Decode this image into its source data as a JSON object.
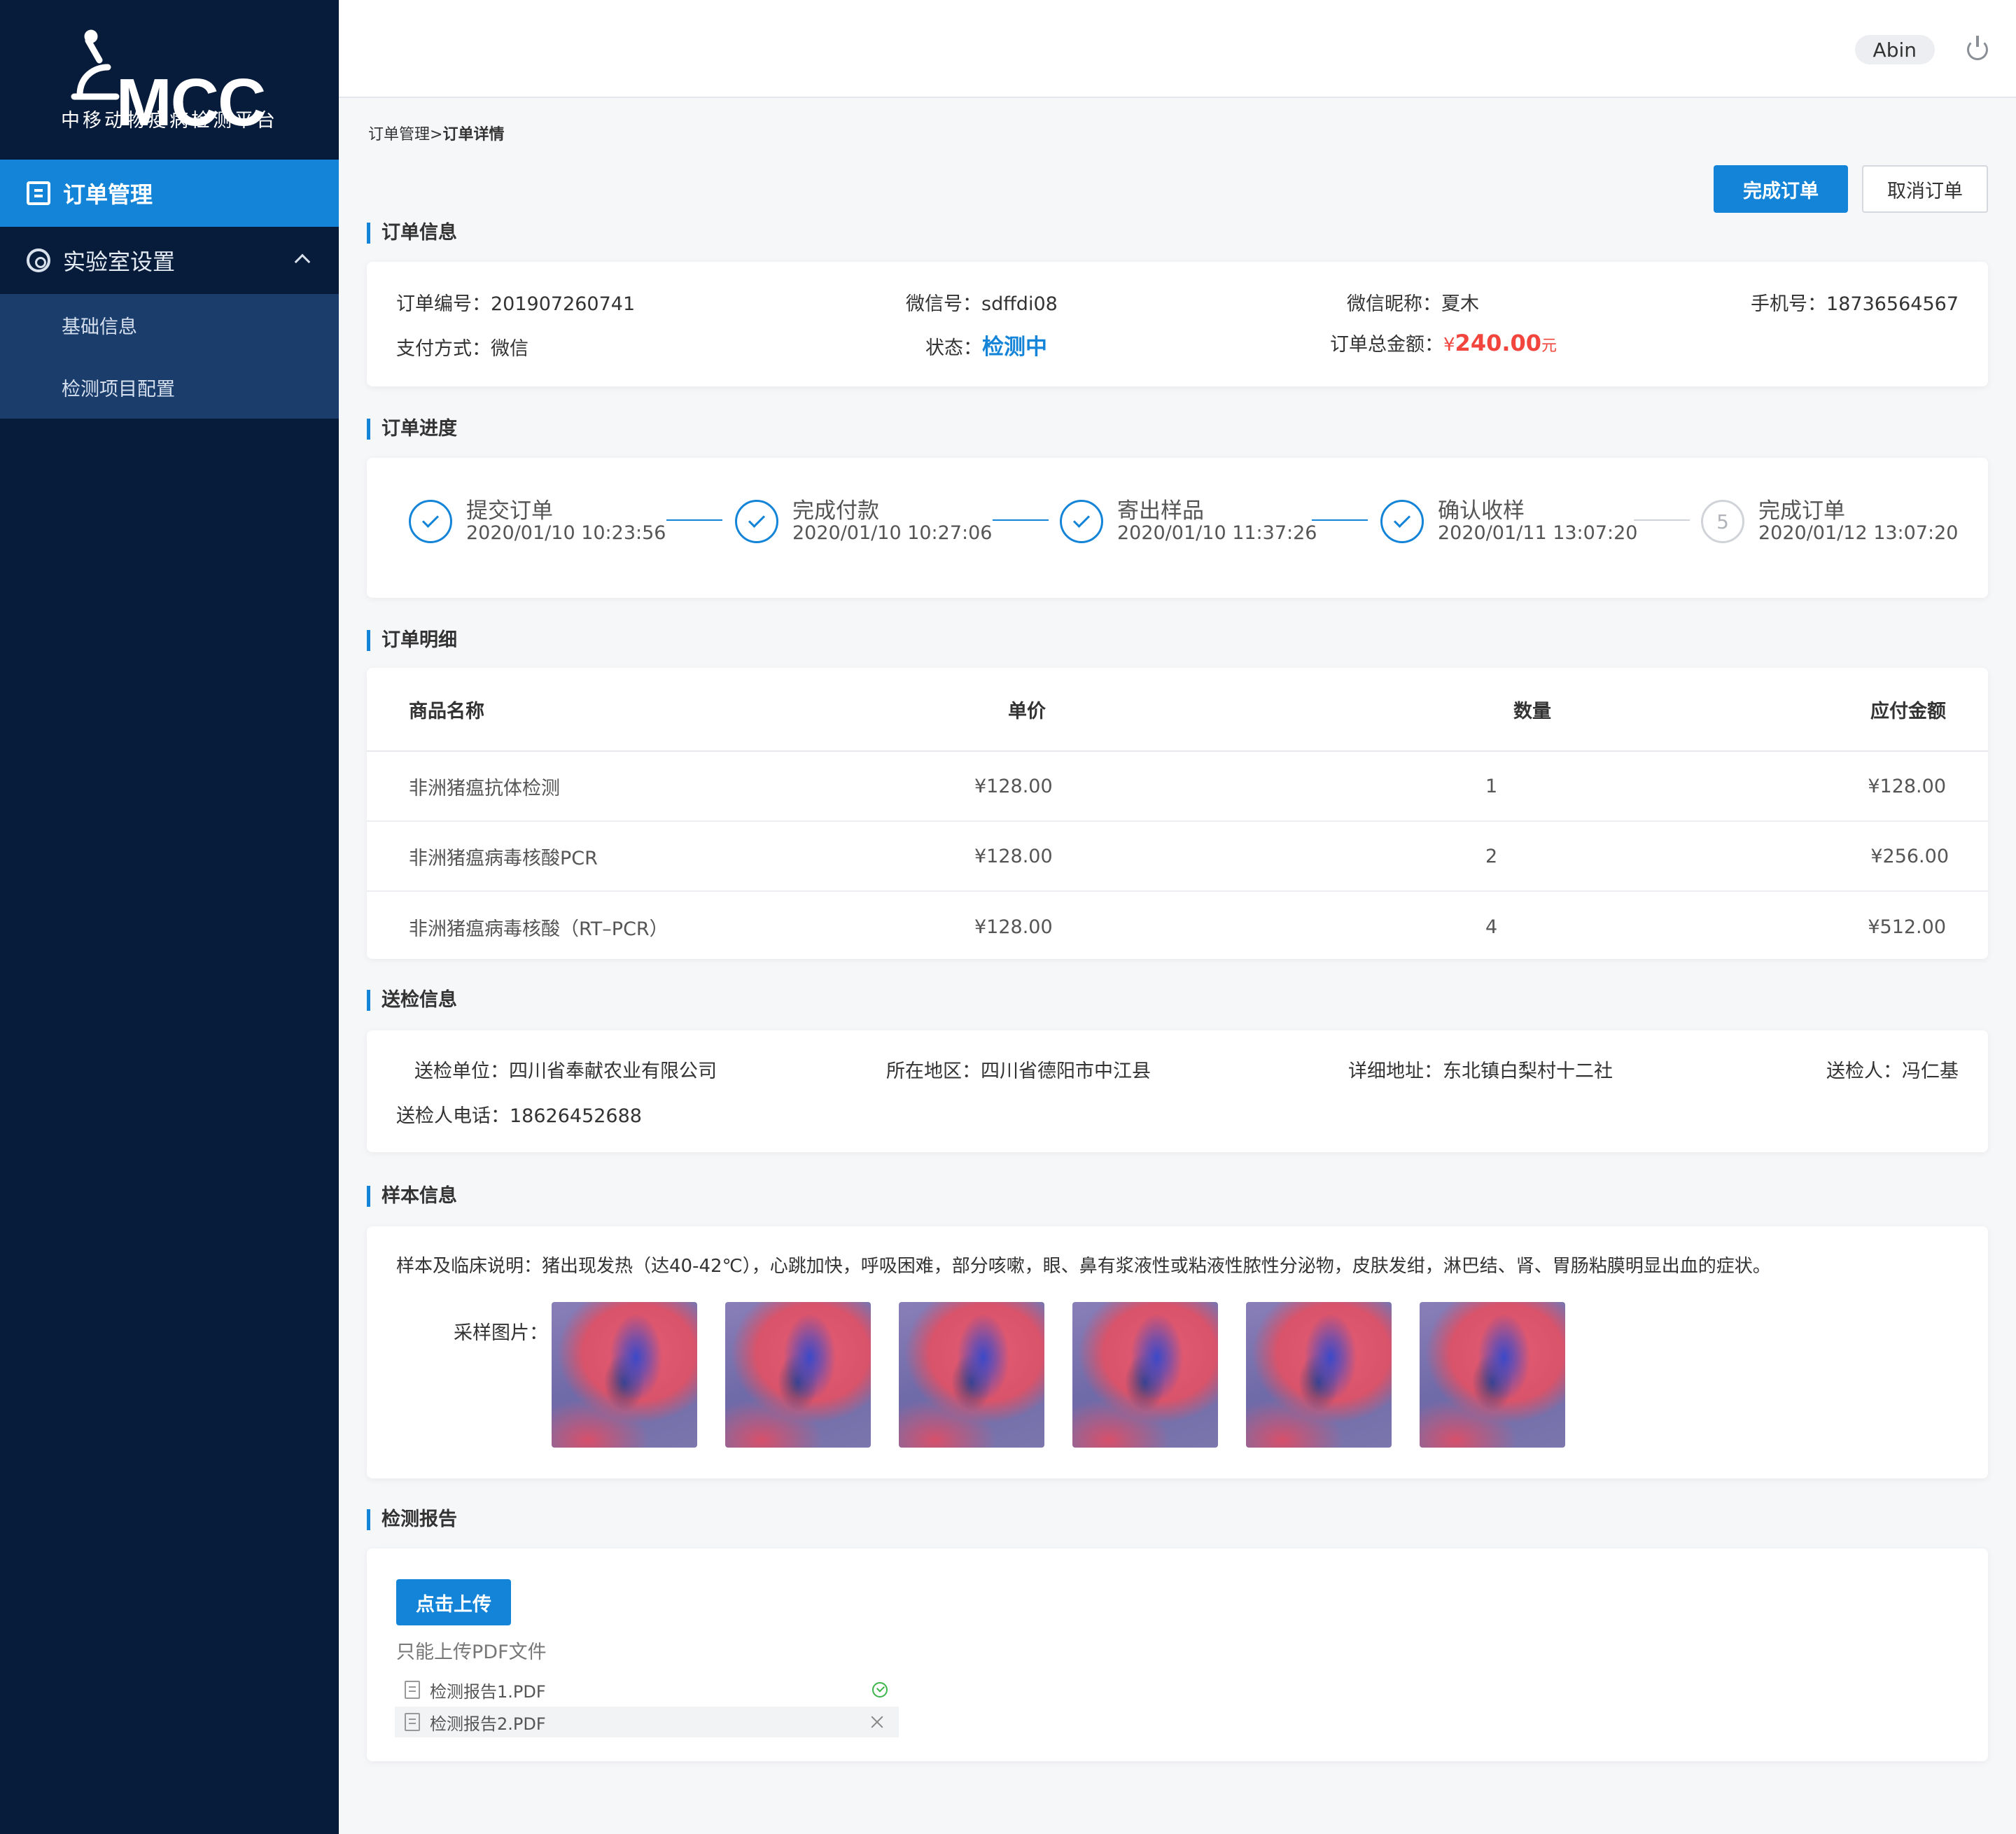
{
  "brand": {
    "logo_text": "MCC",
    "subtitle": "中移动物疫病检测平台"
  },
  "sidebar": {
    "active_item": "订单管理",
    "group": {
      "label": "实验室设置",
      "items": [
        "基础信息",
        "检测项目配置"
      ]
    }
  },
  "header": {
    "user": "Abin"
  },
  "breadcrumb": {
    "parent": "订单管理>",
    "current": "订单详情"
  },
  "actions": {
    "complete": "完成订单",
    "cancel": "取消订单"
  },
  "order_info": {
    "title": "订单信息",
    "order_no_label": "订单编号：",
    "order_no": "201907260741",
    "wechat_label": "微信号：",
    "wechat": "sdffdi08",
    "nickname_label": "微信昵称：",
    "nickname": "夏木",
    "phone_label": "手机号：",
    "phone": "18736564567",
    "pay_label": "支付方式：",
    "pay": "微信",
    "status_label": "状态：",
    "status": "检测中",
    "total_label": "订单总金额：",
    "total_symbol": "¥",
    "total": "240.00",
    "total_unit": "元"
  },
  "progress": {
    "title": "订单进度",
    "steps": [
      {
        "title": "提交订单",
        "time": "2020/01/10 10:23:56"
      },
      {
        "title": "完成付款",
        "time": "2020/01/10 10:27:06"
      },
      {
        "title": "寄出样品",
        "time": "2020/01/10 11:37:26"
      },
      {
        "title": "确认收样",
        "time": "2020/01/11 13:07:20"
      },
      {
        "title": "完成订单",
        "time": "2020/01/12 13:07:20",
        "num": "5"
      }
    ]
  },
  "detail": {
    "title": "订单明细",
    "columns": [
      "商品名称",
      "单价",
      "数量",
      "应付金额"
    ],
    "rows": [
      [
        "非洲猪瘟抗体检测",
        "¥128.00",
        "1",
        "¥128.00"
      ],
      [
        "非洲猪瘟病毒核酸PCR",
        "¥128.00",
        "2",
        "¥256.00"
      ],
      [
        "非洲猪瘟病毒核酸（RT–PCR）",
        "¥128.00",
        "4",
        "¥512.00"
      ]
    ]
  },
  "submission": {
    "title": "送检信息",
    "unit_label": "送检单位：",
    "unit": "四川省奉献农业有限公司",
    "region_label": "所在地区：",
    "region": "四川省德阳市中江县",
    "address_label": "详细地址：",
    "address": "东北镇白梨村十二社",
    "person_label": "送检人：",
    "person": "冯仁基",
    "phone_label": "送检人电话：",
    "phone": "18626452688"
  },
  "sample": {
    "title": "样本信息",
    "desc_label": "样本及临床说明：",
    "desc": "猪出现发热（达40-42℃），心跳加快，呼吸困难，部分咳嗽，眼、鼻有浆液性或粘液性脓性分泌物，皮肤发绀，淋巴结、肾、胃肠粘膜明显出血的症状。",
    "images_label": "采样图片："
  },
  "report": {
    "title": "检测报告",
    "upload": "点击上传",
    "hint": "只能上传PDF文件",
    "files": [
      "检测报告1.PDF",
      "检测报告2.PDF"
    ]
  },
  "colors": {
    "accent": "#1384d8",
    "sidebar": "#071b3a",
    "submenu": "#1b3d6c",
    "price": "#f2453d"
  }
}
